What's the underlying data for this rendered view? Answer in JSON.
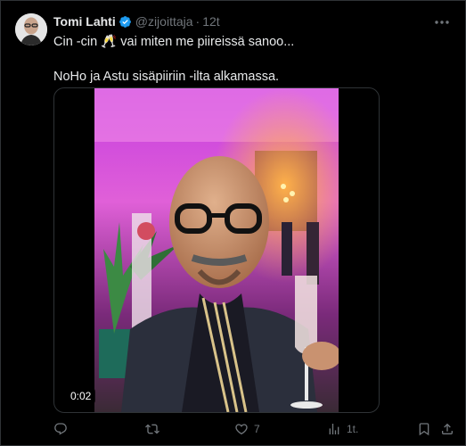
{
  "tweet": {
    "author_name": "Tomi Lahti",
    "handle": "@zijoittaja",
    "dot": "·",
    "time": "12t",
    "line1": "Cin -cin 🥂 vai miten me piireissä sanoo...",
    "line2": "NoHo ja Astu sisäpiiriin -ilta alkamassa.",
    "video_time": "0:02"
  },
  "actions": {
    "reply_count": "",
    "retweet_count": "",
    "like_count": "7",
    "views_count": "1t."
  },
  "icons": {
    "verified": "verified-badge-icon",
    "more": "more-icon",
    "reply": "reply-icon",
    "retweet": "retweet-icon",
    "like": "like-icon",
    "views": "views-icon",
    "bookmark": "bookmark-icon",
    "share": "share-icon"
  },
  "colors": {
    "background": "#000000",
    "text": "#e7e9ea",
    "muted": "#71767b",
    "verified": "#1d9bf0",
    "border": "#2f3336"
  }
}
